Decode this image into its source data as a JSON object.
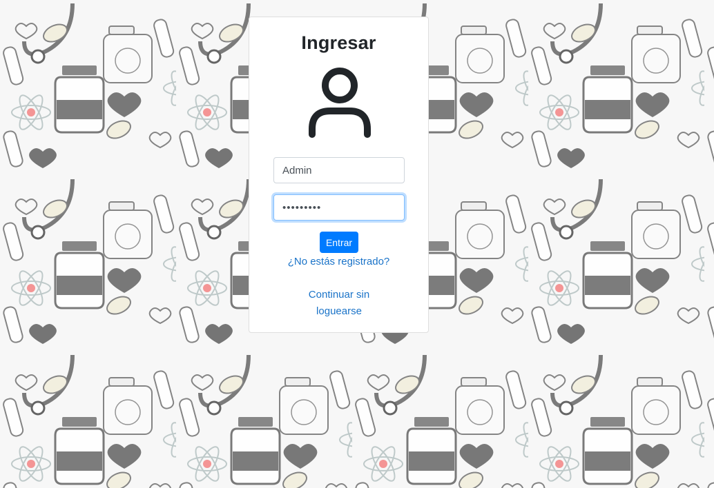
{
  "login": {
    "title": "Ingresar",
    "username_value": "Admin",
    "password_value": "•••••••••",
    "submit_label": "Entrar",
    "register_link": "¿No estás registrado?",
    "guest_link": "Continuar sin loguearse"
  },
  "icons": {
    "avatar": "user-icon"
  },
  "colors": {
    "accent": "#007bff",
    "link": "#1a73c8",
    "title": "#212529"
  }
}
